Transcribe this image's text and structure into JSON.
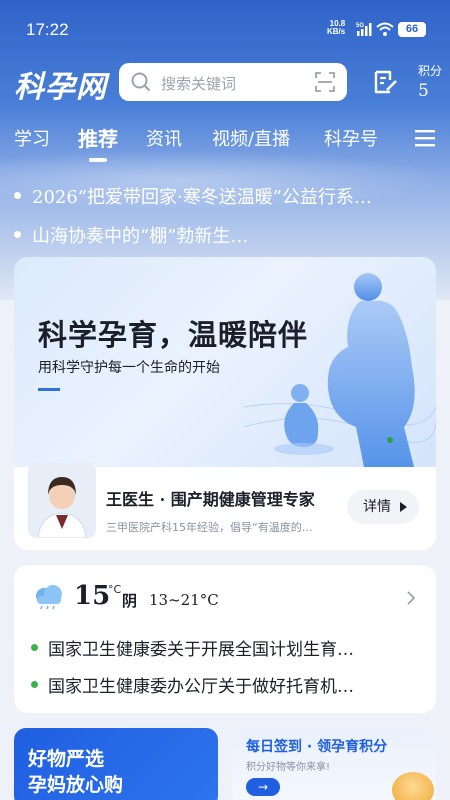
{
  "status_bar": {
    "time": "17:22",
    "net_speed_value": "10.8",
    "net_speed_unit": "KB/s",
    "network_type": "5G",
    "battery": "66"
  },
  "header": {
    "logo": "科孕网",
    "search_placeholder": "搜索关键词",
    "points_label": "积分",
    "points_value": "5"
  },
  "tabs": [
    {
      "label": "学习",
      "active": false
    },
    {
      "label": "推荐",
      "active": true
    },
    {
      "label": "资讯",
      "active": false
    },
    {
      "label": "视频/直播",
      "active": false
    },
    {
      "label": "科孕号",
      "active": false
    }
  ],
  "headlines": [
    "2026“把爱带回家·寒冬送温暖”公益行系…",
    "山海协奏中的“棚”勃新生…"
  ],
  "banner": {
    "title": "科学孕育，温暖陪伴",
    "subtitle": "用科学守护每一个生命的开始",
    "doctor_name": "王医生 · 围产期健康管理专家",
    "doctor_desc": "三甲医院产科15年经验，倡导“有温度的…",
    "detail_label": "详情"
  },
  "weather": {
    "temperature": "15",
    "unit": "°C",
    "condition": "阴",
    "range": "13~21°C",
    "items": [
      "国家卫生健康委关于开展全国计划生育…",
      "国家卫生健康委办公厅关于做好托育机…"
    ]
  },
  "promos": {
    "left_line1": "好物严选",
    "left_line2": "孕妈放心购",
    "right_title": "每日签到 · 领孕育积分",
    "right_sub": "积分好物等你来拿!",
    "right_button": "→"
  },
  "colors": {
    "brand_blue": "#2f63c8",
    "accent_blue": "#1f5fe0",
    "bullet_green": "#3cb24e"
  }
}
